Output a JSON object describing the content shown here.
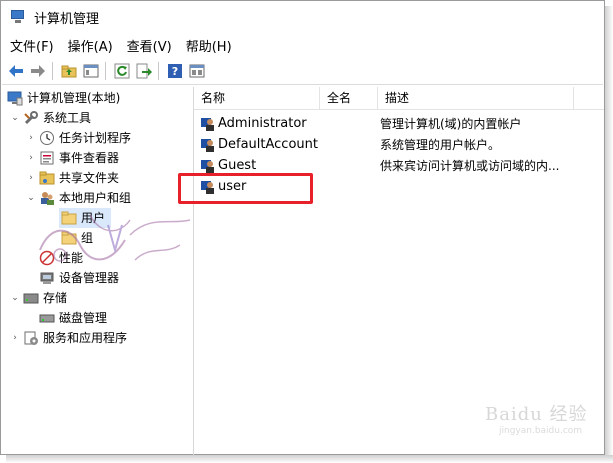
{
  "window": {
    "title": "计算机管理"
  },
  "menu": [
    "文件(F)",
    "操作(A)",
    "查看(V)",
    "帮助(H)"
  ],
  "toolbar": {
    "buttons": [
      "back-icon",
      "forward-icon",
      "up-folder-icon",
      "show-hide-tree-icon",
      "refresh-icon",
      "export-icon",
      "help-icon",
      "properties-icon"
    ]
  },
  "tree": {
    "root": "计算机管理(本地)",
    "system_tools": "系统工具",
    "task_scheduler": "任务计划程序",
    "event_viewer": "事件查看器",
    "shared_folders": "共享文件夹",
    "local_users_groups": "本地用户和组",
    "users": "用户",
    "groups": "组",
    "performance": "性能",
    "device_manager": "设备管理器",
    "storage": "存储",
    "disk_management": "磁盘管理",
    "services_apps": "服务和应用程序"
  },
  "list": {
    "columns": {
      "name": "名称",
      "fullname": "全名",
      "description": "描述"
    },
    "rows": [
      {
        "name": "Administrator",
        "fullname": "",
        "description": "管理计算机(域)的内置帐户"
      },
      {
        "name": "DefaultAccount",
        "fullname": "",
        "description": "系统管理的用户帐户。"
      },
      {
        "name": "Guest",
        "fullname": "",
        "description": "供来宾访问计算机或访问域的内..."
      },
      {
        "name": "user",
        "fullname": "",
        "description": ""
      }
    ]
  },
  "watermarks": {
    "baidu": "Baidu 经验",
    "baidu_url": "jingyan.baidu.com"
  },
  "colors": {
    "highlight_box": "#e8202a",
    "selection": "#d9e8fb"
  }
}
